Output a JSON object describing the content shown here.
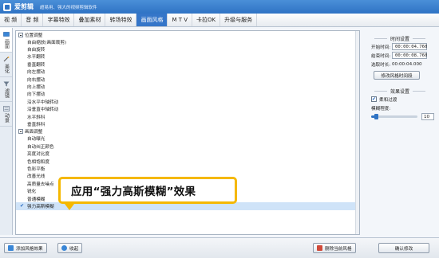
{
  "app": {
    "name": "爱剪辑",
    "slogan": "超易用、强大的视频剪辑软件"
  },
  "menu": {
    "tabs": [
      {
        "label": "视  频"
      },
      {
        "label": "音  频"
      },
      {
        "label": "字幕特效"
      },
      {
        "label": "叠加素材"
      },
      {
        "label": "转场特效"
      },
      {
        "label": "画面风格"
      },
      {
        "label": "M T V"
      },
      {
        "label": "卡拉OK"
      },
      {
        "label": "升级与服务"
      }
    ],
    "active_index": 5
  },
  "side_tabs": [
    {
      "label": "画面",
      "icon": "screen-icon"
    },
    {
      "label": "美化",
      "icon": "wand-icon"
    },
    {
      "label": "滤镜",
      "icon": "filter-icon"
    },
    {
      "label": "动景",
      "icon": "motion-icon"
    }
  ],
  "list": {
    "groups": [
      {
        "title": "位置调整",
        "items": [
          "自由缩放(画面裁剪)",
          "自由旋转",
          "水平翻转",
          "垂直翻转",
          "向左摆动",
          "向右摆动",
          "向上摆动",
          "向下摆动",
          "沿水平中轴转动",
          "沿垂直中轴转动",
          "水平斜科",
          "垂直斜科"
        ]
      },
      {
        "title": "画面调整",
        "items": [
          "自动曝光",
          "自动纠正颜色",
          "亮度对比度",
          "色相饱和度",
          "色彩平衡",
          "改善光线",
          "高质量去噪点",
          "锐化",
          "普通模糊",
          "强力高斯模糊"
        ]
      }
    ],
    "selected_item": "强力高斯模糊"
  },
  "callout": {
    "text": "应用“强力高斯模糊”效果"
  },
  "time_settings": {
    "title": "时间设置",
    "start_label": "开始时间:",
    "start_value": "00:00:04.760",
    "end_label": "结束时间:",
    "end_value": "00:00:08.760",
    "duration_label": "选取时长:",
    "duration_value": "00:00:04.000",
    "modify_button": "修改风格时间段"
  },
  "effect_settings": {
    "title": "效果设置",
    "soft_transition_label": "柔和过渡",
    "soft_transition_checked": true,
    "blur_label": "模糊程度:",
    "blur_value": "10",
    "blur_fraction": 0.1
  },
  "bottom": {
    "add_style_label": "添加风格效果",
    "collapse_label": "收起",
    "delete_style_label": "删除当前风格",
    "confirm_label": "确认修改"
  },
  "colors": {
    "accent": "#2f73c4",
    "callout_border": "#f5b800",
    "selected_row": "#cfe3f8"
  }
}
